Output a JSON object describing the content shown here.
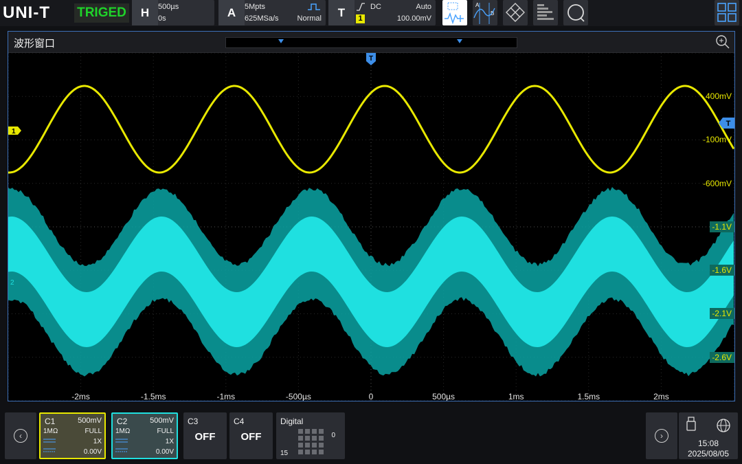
{
  "header": {
    "logo": "UNI-T",
    "trigger_status": "TRIGED",
    "horizontal": {
      "letter": "H",
      "timebase": "500µs",
      "offset": "0s"
    },
    "acquire": {
      "letter": "A",
      "depth": "5Mpts",
      "mode": "Normal",
      "rate": "625MSa/s"
    },
    "trigger": {
      "letter": "T",
      "coupling": "DC",
      "sweep": "Auto",
      "source": "1",
      "level": "100.00mV"
    }
  },
  "window": {
    "title": "波形窗口"
  },
  "scale_right_ch1": [
    "400mV",
    "-100mV",
    "-600mV"
  ],
  "scale_right_ch2": [
    "-1.1V",
    "-1.6V",
    "-2.1V",
    "-2.6V"
  ],
  "time_labels": [
    "-2ms",
    "-1.5ms",
    "-1ms",
    "-500µs",
    "0",
    "500µs",
    "1ms",
    "1.5ms",
    "2ms"
  ],
  "markers": {
    "trigger_top": "T",
    "trigger_right": "T",
    "ch1": "1",
    "ch2": "2"
  },
  "channels": [
    {
      "name": "C1",
      "scale": "500mV",
      "impedance": "1MΩ",
      "bandwidth": "FULL",
      "probe": "1X",
      "offset": "0.00V",
      "color": "#e8e800"
    },
    {
      "name": "C2",
      "scale": "500mV",
      "impedance": "1MΩ",
      "bandwidth": "FULL",
      "probe": "1X",
      "offset": "0.00V",
      "color": "#1fe0e0"
    },
    {
      "name": "C3",
      "state": "OFF"
    },
    {
      "name": "C4",
      "state": "OFF"
    }
  ],
  "digital": {
    "label": "Digital",
    "low": "15",
    "high": "0"
  },
  "clock": {
    "time": "15:08",
    "date": "2025/08/05"
  },
  "colors": {
    "ch1": "#e8e800",
    "ch2": "#1fe0e0",
    "accent": "#3d70b8"
  }
}
